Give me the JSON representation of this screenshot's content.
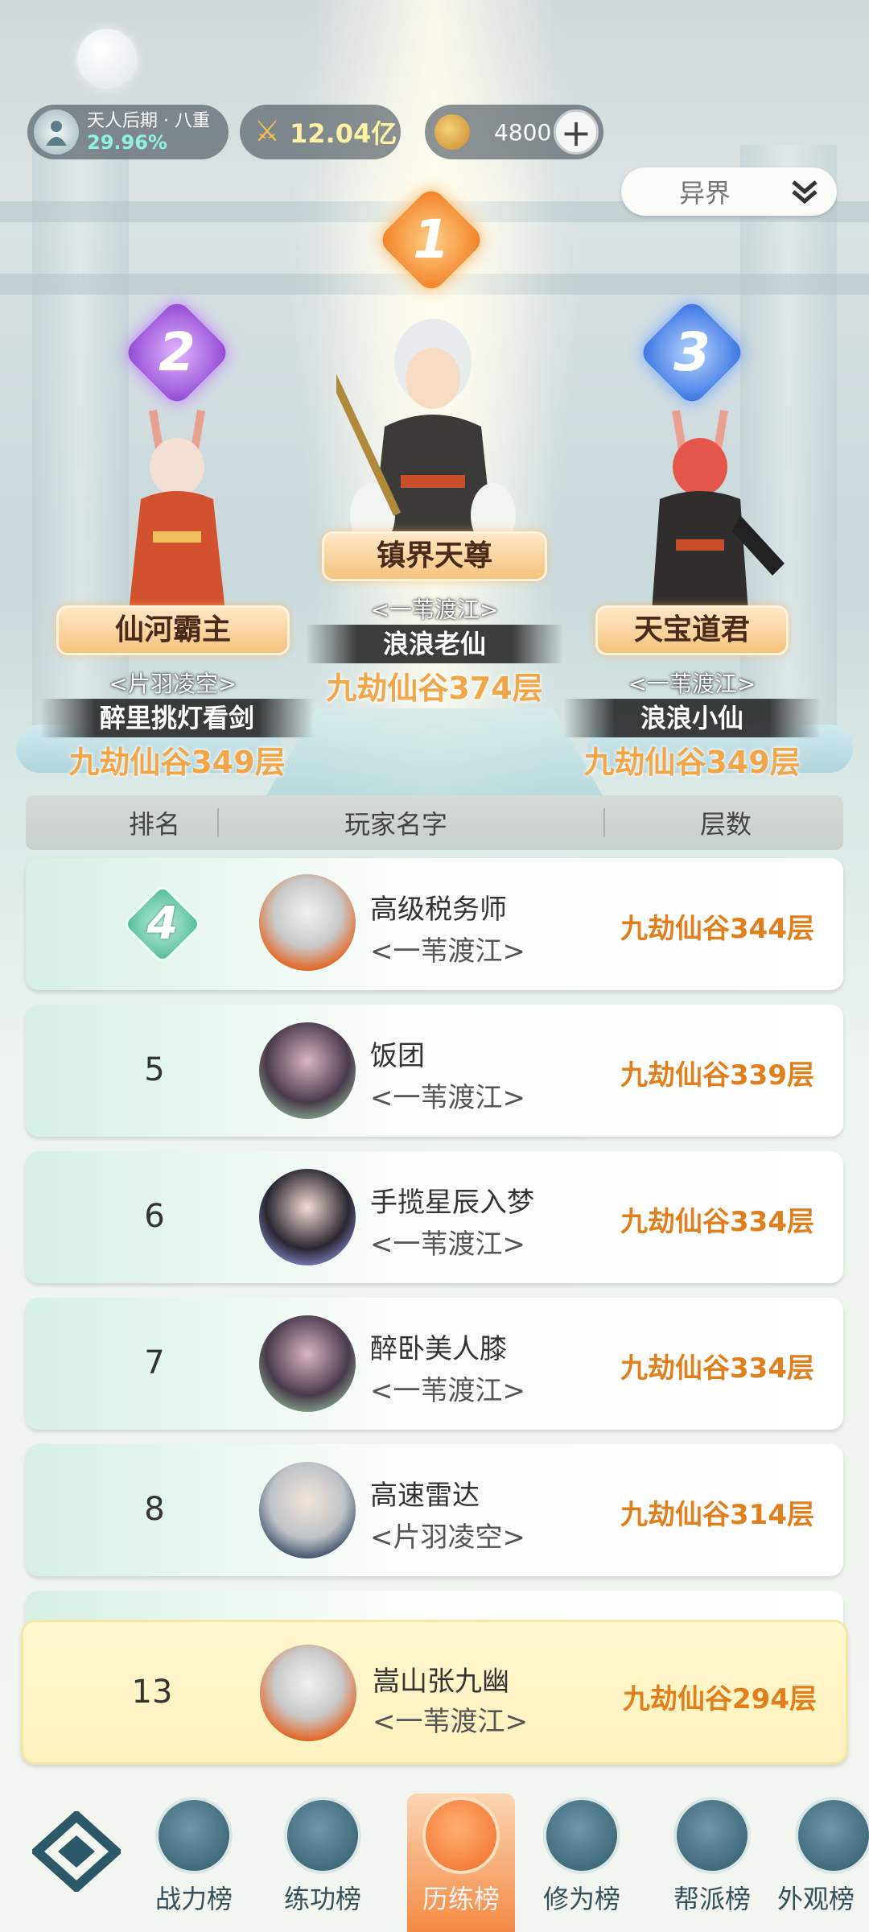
{
  "status_bar": {
    "realm_name": "天人后期 · 八重",
    "realm_progress": "29.96%",
    "power": "12.04亿",
    "currency": "4800",
    "add_icon": "plus-icon"
  },
  "server_select": {
    "label": "异界",
    "icon": "chevron-down-icon"
  },
  "podium": [
    {
      "rank": "1",
      "title": "镇界天尊",
      "guild": "<一苇渡江>",
      "player": "浪浪老仙",
      "floor": "九劫仙谷374层",
      "color": "#f07a1e"
    },
    {
      "rank": "2",
      "title": "仙河霸主",
      "guild": "<片羽凌空>",
      "player": "醉里挑灯看剑",
      "floor": "九劫仙谷349层",
      "color": "#a55ae0"
    },
    {
      "rank": "3",
      "title": "天宝道君",
      "guild": "<一苇渡江>",
      "player": "浪浪小仙",
      "floor": "九劫仙谷349层",
      "color": "#3d7de8"
    }
  ],
  "table": {
    "headers": [
      "排名",
      "玩家名字",
      "层数"
    ],
    "rows": [
      {
        "rank": "4",
        "name": "高级税务师",
        "guild": "<一苇渡江>",
        "floor": "九劫仙谷344层"
      },
      {
        "rank": "5",
        "name": "饭团",
        "guild": "<一苇渡江>",
        "floor": "九劫仙谷339层"
      },
      {
        "rank": "6",
        "name": "手揽星辰入梦",
        "guild": "<一苇渡江>",
        "floor": "九劫仙谷334层"
      },
      {
        "rank": "7",
        "name": "醉卧美人膝",
        "guild": "<一苇渡江>",
        "floor": "九劫仙谷334层"
      },
      {
        "rank": "8",
        "name": "高速雷达",
        "guild": "<片羽凌空>",
        "floor": "九劫仙谷314层"
      }
    ]
  },
  "my_rank": {
    "rank": "13",
    "name": "嵩山张九幽",
    "guild": "<一苇渡江>",
    "floor": "九劫仙谷294层"
  },
  "bottom_nav": [
    {
      "label": "战力榜",
      "icon": "swords-icon"
    },
    {
      "label": "练功榜",
      "icon": "yin-yang-icon"
    },
    {
      "label": "历练榜",
      "icon": "star-compass-icon",
      "active": true
    },
    {
      "label": "修为榜",
      "icon": "scholar-hat-icon"
    },
    {
      "label": "帮派榜",
      "icon": "banner-icon"
    },
    {
      "label": "外观榜",
      "icon": "costume-icon"
    }
  ]
}
